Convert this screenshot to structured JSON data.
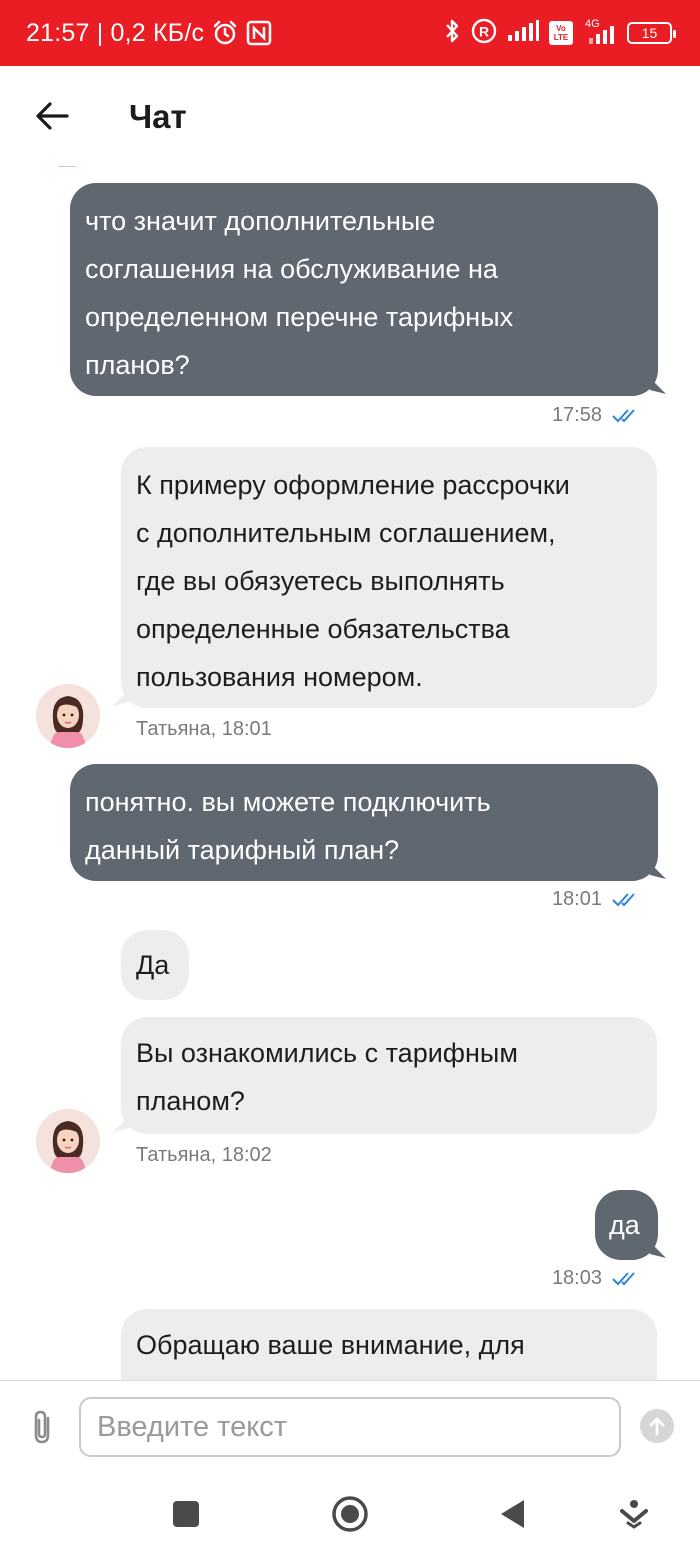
{
  "status_bar": {
    "time_net": "21:57 | 0,2 КБ/с",
    "network_4g": "4G",
    "volte": "Vo LTE",
    "battery": "15"
  },
  "header": {
    "title": "Чат"
  },
  "messages": [
    {
      "direction": "out",
      "text": "что значит дополнительные\nсоглашения на обслуживание на\nопределенном перечне тарифных\nпланов?",
      "time": "17:58"
    },
    {
      "direction": "in",
      "text": "К примеру оформление рассрочки\nс дополнительным соглашением,\nгде вы обязуетесь выполнять\nопределенные обязательства\nпользования номером.",
      "meta": "Татьяна, 18:01"
    },
    {
      "direction": "out",
      "text": "понятно. вы можете подключить\nданный тарифный план?",
      "time": "18:01"
    },
    {
      "direction": "in",
      "text": "Да"
    },
    {
      "direction": "in",
      "text": "Вы ознакомились с тарифным\nпланом?",
      "meta": "Татьяна, 18:02"
    },
    {
      "direction": "out",
      "text": "да",
      "time": "18:03"
    },
    {
      "direction": "in",
      "text": "Обращаю ваше внимание, для"
    }
  ],
  "composer": {
    "placeholder": "Введите текст"
  },
  "colors": {
    "status_bar": "#ea1c24",
    "outgoing_bubble": "#5f6770",
    "incoming_bubble": "#ededed",
    "read_check": "#2f86d6"
  }
}
